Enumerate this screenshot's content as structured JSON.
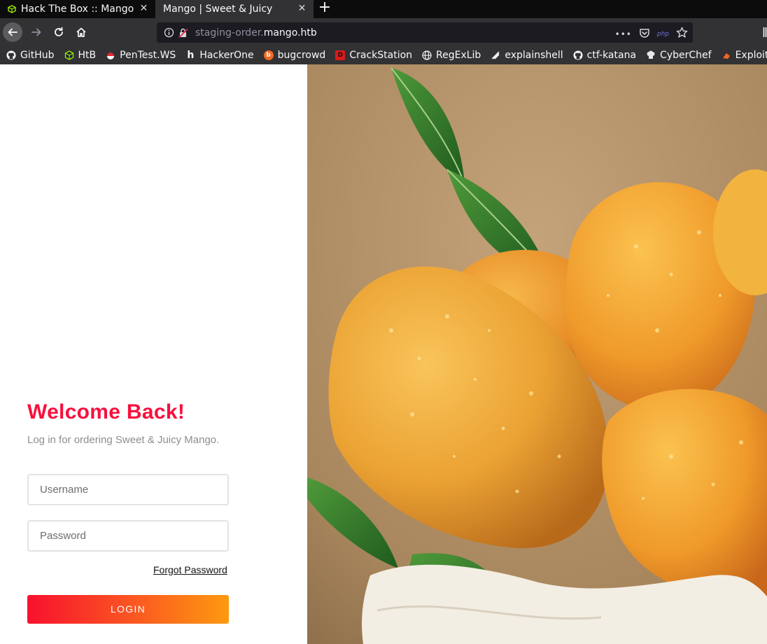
{
  "browser": {
    "tabs": [
      {
        "title": "Hack The Box :: Mango",
        "active": false
      },
      {
        "title": "Mango | Sweet & Juicy",
        "active": true
      }
    ],
    "new_tab_glyph": "+",
    "close_glyph": "✕",
    "url": {
      "prefix": "staging-order.",
      "host": "mango.htb"
    },
    "url_actions": {
      "more": "•••",
      "php_badge": "php"
    },
    "bookmarks": [
      {
        "label": "GitHub",
        "icon": "github-icon",
        "color": "#f9f9fa"
      },
      {
        "label": "HtB",
        "icon": "htb-icon",
        "color": "#9fef00"
      },
      {
        "label": "PenTest.WS",
        "icon": "pentestws-icon",
        "color": "#e0282f"
      },
      {
        "label": "HackerOne",
        "icon": "hackerone-icon",
        "color": "#f9f9fa"
      },
      {
        "label": "bugcrowd",
        "icon": "bugcrowd-icon",
        "color": "#f26822"
      },
      {
        "label": "CrackStation",
        "icon": "crackstation-icon",
        "color": "#d91c1c"
      },
      {
        "label": "RegExLib",
        "icon": "globe-icon",
        "color": "#f9f9fa"
      },
      {
        "label": "explainshell",
        "icon": "explainshell-icon",
        "color": "#f9f9fa"
      },
      {
        "label": "ctf-katana",
        "icon": "github-icon",
        "color": "#f9f9fa"
      },
      {
        "label": "CyberChef",
        "icon": "cyberchef-icon",
        "color": "#f9f9fa"
      },
      {
        "label": "Exploit-DB",
        "icon": "exploitdb-icon",
        "color": "#f26822"
      }
    ]
  },
  "login": {
    "heading": "Welcome Back!",
    "subtitle": "Log in for ordering Sweet & Juicy Mango.",
    "username_placeholder": "Username",
    "password_placeholder": "Password",
    "forgot_label": "Forgot Password",
    "submit_label": "LOGIN"
  },
  "colors": {
    "accent": "#f7113e",
    "button_gradient_start": "#f7112e",
    "button_gradient_end": "#fd9a0f"
  }
}
